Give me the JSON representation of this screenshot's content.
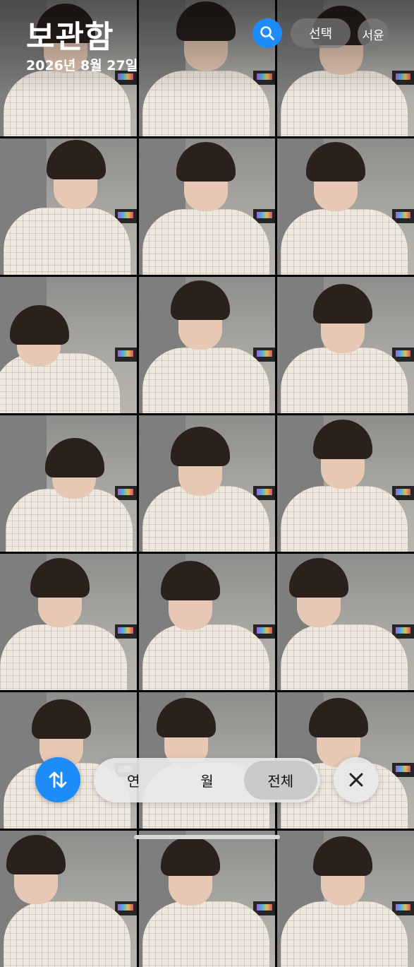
{
  "header": {
    "title": "보관함",
    "date": "2026년 8월 27일",
    "select_label": "선택",
    "profile_label": "서윤",
    "search_icon": "search-icon"
  },
  "grid": {
    "photos": [
      {
        "label": "photo-1"
      },
      {
        "label": "photo-2"
      },
      {
        "label": "photo-3"
      },
      {
        "label": "photo-4"
      },
      {
        "label": "photo-5"
      },
      {
        "label": "photo-6"
      },
      {
        "label": "photo-7"
      },
      {
        "label": "photo-8"
      },
      {
        "label": "photo-9"
      },
      {
        "label": "photo-10"
      },
      {
        "label": "photo-11"
      },
      {
        "label": "photo-12"
      },
      {
        "label": "photo-13"
      },
      {
        "label": "photo-14"
      },
      {
        "label": "photo-15"
      },
      {
        "label": "photo-16"
      },
      {
        "label": "photo-17"
      },
      {
        "label": "photo-18"
      },
      {
        "label": "photo-19"
      },
      {
        "label": "photo-20"
      },
      {
        "label": "photo-21"
      }
    ]
  },
  "bottom_bar": {
    "sort_icon": "sort-arrows-icon",
    "segments": [
      "연",
      "월",
      "전체"
    ],
    "selected_segment": "전체",
    "close_icon": "close-icon"
  },
  "colors": {
    "accent": "#1d8cf8",
    "pill_bg": "#e8e8e8",
    "selected_segment_bg": "#c9c9c9"
  }
}
